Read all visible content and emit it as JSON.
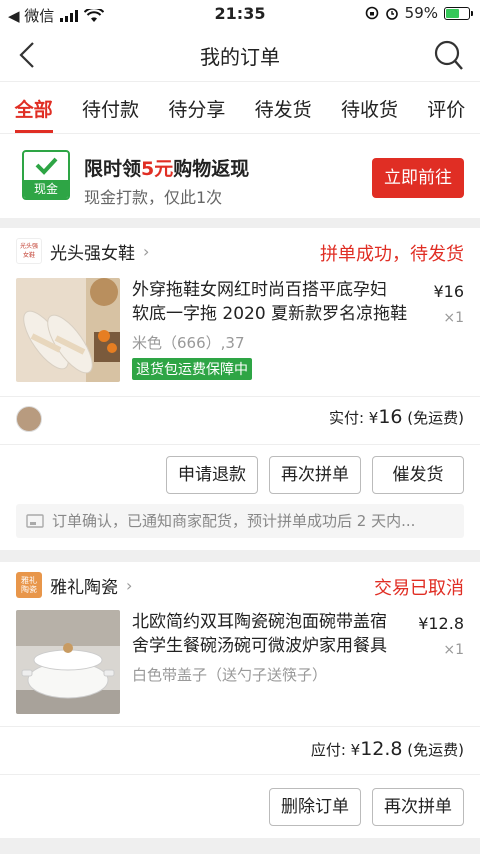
{
  "status_bar": {
    "carrier": "◀ 微信",
    "time": "21:35",
    "battery_pct": "59%",
    "battery_level": 0.59
  },
  "nav": {
    "title": "我的订单",
    "back_icon": "chevron-left-icon",
    "search_icon": "search-icon"
  },
  "tabs": [
    {
      "label": "全部",
      "active": true
    },
    {
      "label": "待付款"
    },
    {
      "label": "待分享"
    },
    {
      "label": "待发货"
    },
    {
      "label": "待收货"
    },
    {
      "label": "评价"
    }
  ],
  "promo": {
    "title_prefix": "限时领",
    "title_highlight": "5元",
    "title_suffix": "购物返现",
    "subtitle": "现金打款，仅此1次",
    "badge_label": "现金",
    "button": "立即前往"
  },
  "orders": [
    {
      "shop_name": "光头强女鞋",
      "shop_logo_text": "光头强女鞋",
      "status": "拼单成功，待发货",
      "product_line1": "外穿拖鞋女网红时尚百搭平底孕妇",
      "product_line2": "软底一字拖 2020 夏新款罗名凉拖鞋",
      "spec": "米色（666）,37",
      "price": "¥16",
      "qty": "×1",
      "guarantee": "退货包运费保障中",
      "pay_label": "实付: ",
      "pay_currency": "¥",
      "pay_amount": "16",
      "pay_note": " (免运费)",
      "buttons": [
        "申请退款",
        "再次拼单",
        "催发货"
      ],
      "notice": "订单确认，已通知商家配货，预计拼单成功后 2 天内..."
    },
    {
      "shop_name": "雅礼陶瓷",
      "shop_logo_text": "雅礼陶瓷",
      "status": "交易已取消",
      "product_line1": "北欧简约双耳陶瓷碗泡面碗带盖宿",
      "product_line2": "舍学生餐碗汤碗可微波炉家用餐具",
      "spec": "白色带盖子（送勺子送筷子）",
      "price": "¥12.8",
      "qty": "×1",
      "pay_label": "应付: ",
      "pay_currency": "¥",
      "pay_amount": "12.8",
      "pay_note": " (免运费)",
      "buttons": [
        "删除订单",
        "再次拼单"
      ]
    }
  ],
  "colors": {
    "accent": "#e02e24",
    "green": "#2ea545"
  }
}
